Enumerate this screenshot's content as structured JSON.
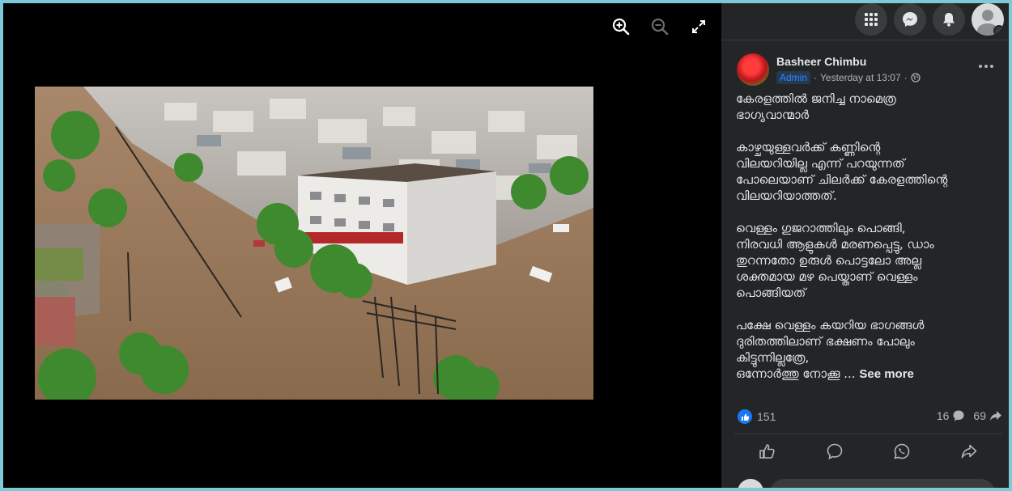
{
  "viewer": {
    "tools": [
      {
        "name": "zoom-in-icon"
      },
      {
        "name": "zoom-out-icon"
      },
      {
        "name": "fullscreen-icon"
      }
    ],
    "photo_description_name": "flood-aerial-photo"
  },
  "topbar": {
    "icons": [
      "menu-grid-icon",
      "messenger-icon",
      "bell-icon",
      "profile-avatar"
    ]
  },
  "post": {
    "author": "Basheer Chimbu",
    "badge": "Admin",
    "time": "Yesterday at 13:07",
    "privacy_icon": "globe-icon",
    "text": "കേരളത്തിൽ ജനിച്ച നാമെത്ര\nഭാഗ്യവാന്മാർ\n\nകാഴ്ചയുള്ളവർക്ക് കണ്ണിന്റെ\nവിലയറിയില്ല എന്ന് പറയുന്നത്\nപോലെയാണ് ചിലർക്ക് കേരളത്തിന്റെ\nവിലയറിയാത്തത്.\n\nവെള്ളം ഗുജറാത്തിലും പൊങ്ങി,\nനിരവധി ആളുകൾ മരണപ്പെട്ടു, ഡാം\nതുറന്നതോ ഉരുൾ പൊട്ടലോ അല്ല\nശക്തമായ മഴ പെയ്താണ് വെള്ളം\nപൊങ്ങിയത്\n\nപക്ഷേ വെള്ളം കയറിയ ഭാഗങ്ങൾ\nദുരിതത്തിലാണ് ഭക്ഷണം പോലും\nകിട്ടുന്നില്ലത്രേ,\nഒന്നോർത്തു നോക്കൂ ... ",
    "see_more": "See more"
  },
  "counts": {
    "likes": "151",
    "comments": "16",
    "shares": "69"
  },
  "actions": [
    "like-icon",
    "comment-icon",
    "whatsapp-icon",
    "share-icon"
  ],
  "colors": {
    "panel_bg": "#242526",
    "accent": "#1877f2",
    "text": "#e4e6eb",
    "muted": "#b0b3b8"
  }
}
